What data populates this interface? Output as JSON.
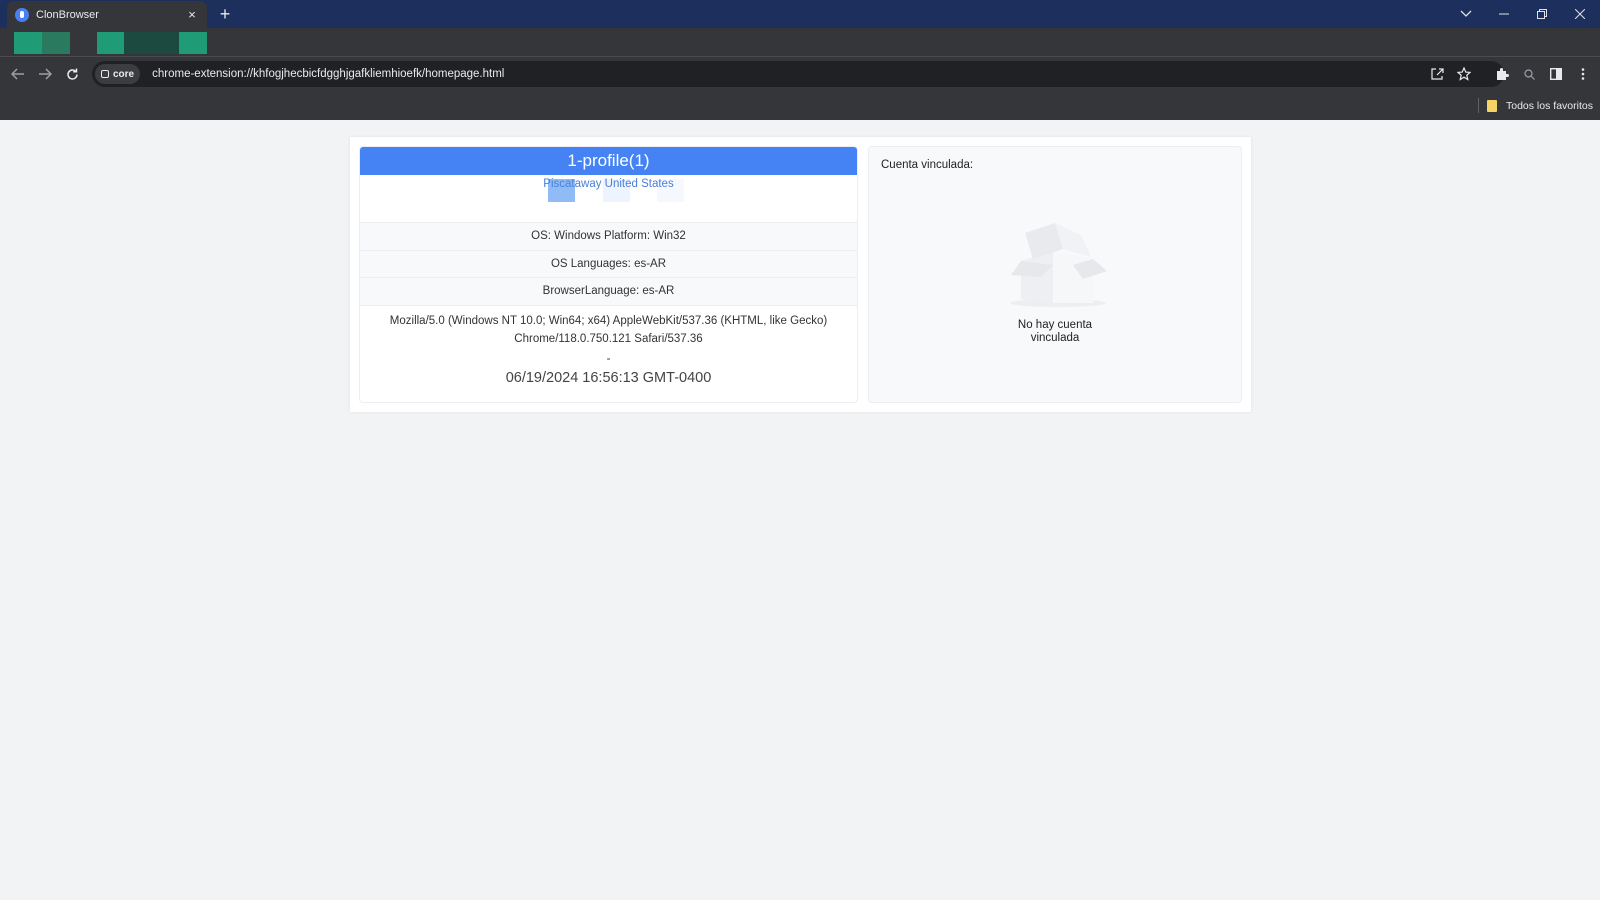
{
  "browser": {
    "tab_title": "ClonBrowser",
    "tab_close": "×",
    "new_tab": "+",
    "chip_label": "core",
    "url": "chrome-extension://khfogjhecbicfdgghjgafkliemhioefk/homepage.html",
    "bookmark_label": "Todos los favoritos",
    "swatch_colors": [
      "#1f9b76",
      "#2a7a5f",
      "#1f9b76",
      "#1d4a40",
      "#1f9b76"
    ]
  },
  "profile": {
    "name": "1-profile(1)",
    "location": "Piscataway United States",
    "os": "OS: Windows Platform: Win32",
    "os_languages": "OS Languages: es-AR",
    "browser_language": "BrowserLanguage: es-AR",
    "user_agent_line1": "Mozilla/5.0 (Windows NT 10.0; Win64; x64) AppleWebKit/537.36 (KHTML, like Gecko)",
    "user_agent_line2": "Chrome/118.0.750.121 Safari/537.36",
    "dash": "-",
    "timestamp": "06/19/2024 16:56:13 GMT-0400"
  },
  "linked_account": {
    "title": "Cuenta vinculada:",
    "empty_line1": "No hay cuenta",
    "empty_line2": "vinculada"
  },
  "colors": {
    "accent": "#4583f5",
    "tab_bar": "#1c2f5d",
    "toolbar": "#35363a",
    "page_bg": "#f2f3f5"
  }
}
